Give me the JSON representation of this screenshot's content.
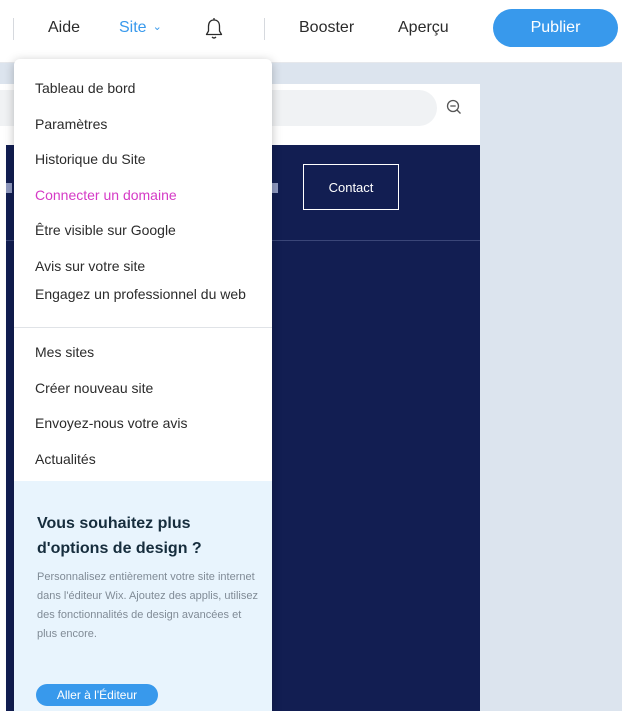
{
  "topbar": {
    "help": "Aide",
    "site": "Site",
    "boost": "Booster",
    "preview": "Aperçu",
    "publish": "Publier"
  },
  "site_preview": {
    "contact_label": "Contact"
  },
  "site_menu": {
    "items": [
      {
        "label": "Tableau de bord"
      },
      {
        "label": "Paramètres"
      },
      {
        "label": "Historique du Site"
      },
      {
        "label": "Connecter un domaine"
      },
      {
        "label": "Être visible sur Google"
      },
      {
        "label": "Avis sur votre site"
      },
      {
        "label": "Engagez un professionnel du web"
      },
      {
        "label": "Mes sites"
      },
      {
        "label": "Créer nouveau site"
      },
      {
        "label": "Envoyez-nous votre avis"
      },
      {
        "label": "Actualités"
      }
    ],
    "promo": {
      "title": "Vous souhaitez plus d'options de design ?",
      "text": "Personnalisez entièrement votre site internet dans l'éditeur Wix. Ajoutez des applis, utilisez des fonctionnalités de design avancées et plus encore.",
      "button": "Aller à l'Éditeur"
    }
  },
  "colors": {
    "accent": "#3899ec",
    "highlight": "#d53ac6",
    "site_background": "#121e52",
    "canvas": "#dce4ee",
    "promo_background": "#e8f4fd"
  },
  "icons": {
    "chevron": "chevron-down-icon",
    "notifications": "bell-icon",
    "zoom": "zoom-out-icon"
  }
}
